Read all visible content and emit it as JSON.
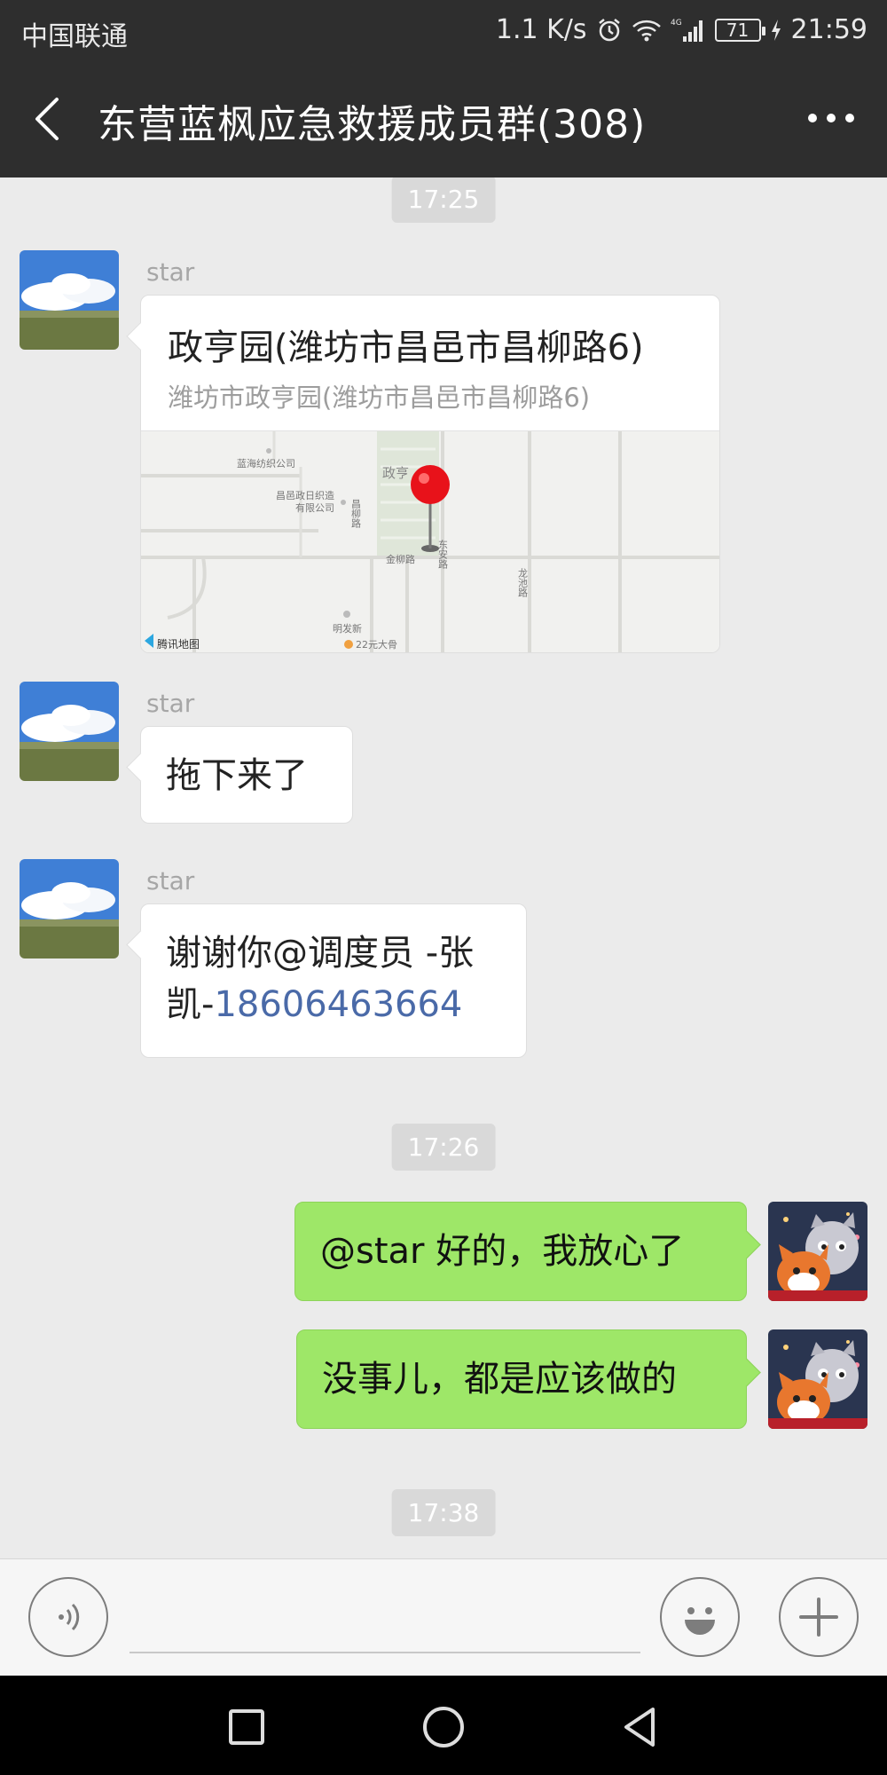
{
  "status_bar": {
    "carrier": "中国联通",
    "speed": "1.1 K/s",
    "network": "4G",
    "battery": "71",
    "time": "21:59"
  },
  "title_bar": {
    "title": "东营蓝枫应急救援成员群(308)"
  },
  "chat": {
    "timestamps": [
      "17:25",
      "17:26",
      "17:38"
    ],
    "messages": [
      {
        "sender": "star",
        "type": "location",
        "title": "政亨园(潍坊市昌邑市昌柳路6)",
        "address": "潍坊市政亨园(潍坊市昌邑市昌柳路6)",
        "map_labels": {
          "company1": "蓝海纺织公司",
          "company2_line1": "昌邑政日织造",
          "company2_line2": "有限公司",
          "changliu_road": "昌柳路",
          "poi": "政亨",
          "jinliu_road": "金柳路",
          "dongan_road": "东安路",
          "longchi_road": "龙池路",
          "mingfa": "明发新",
          "dayu": "22元大骨",
          "brand": "腾讯地图"
        }
      },
      {
        "sender": "star",
        "type": "text",
        "text": "拖下来了"
      },
      {
        "sender": "star",
        "type": "text",
        "text_part1": "谢谢你@调度员 -张",
        "text_part2": "凯-",
        "phone": "18606463664"
      },
      {
        "sender": "me",
        "type": "text",
        "text": "@star  好的，我放心了"
      },
      {
        "sender": "me",
        "type": "text",
        "text": "没事儿，都是应该做的"
      }
    ]
  },
  "colors": {
    "header_bg": "#2e2e2e",
    "chat_bg": "#ebebeb",
    "my_bubble": "#9ee768",
    "their_bubble": "#ffffff",
    "link": "#4a6aa8"
  }
}
